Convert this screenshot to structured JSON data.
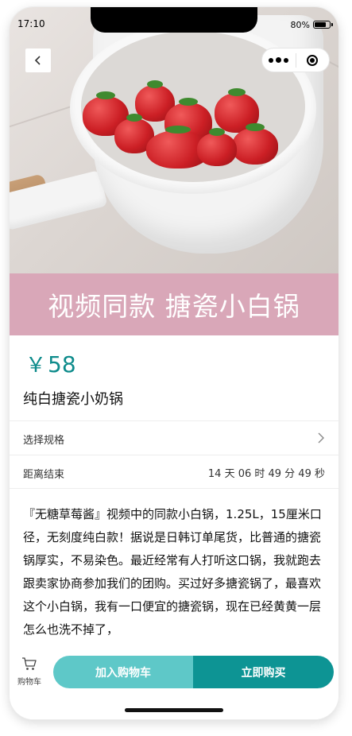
{
  "status_bar": {
    "time": "17:10",
    "battery_text": "80%",
    "battery_level": 0.8
  },
  "hero": {
    "banner_text": "视频同款 搪瓷小白锅",
    "banner_color": "#d9a7b8"
  },
  "product": {
    "currency": "￥",
    "price": "58",
    "title": "纯白搪瓷小奶锅",
    "price_color": "#0d8b8b"
  },
  "rows": {
    "spec_label": "选择规格",
    "countdown_label": "距离结束",
    "countdown_value": "14 天 06 时 49 分 49 秒"
  },
  "description": {
    "text": "『无糖草莓酱』视频中的同款小白锅，1.25L，15厘米口径，无刻度纯白款！据说是日韩订单尾货，比普通的搪瓷锅厚实，不易染色。最近经常有人打听这口锅，我就跑去跟卖家协商参加我们的团购。买过好多搪瓷锅了，最喜欢这个小白锅，我有一口便宜的搪瓷锅，现在已经黄黄一层怎么也洗不掉了，"
  },
  "bottom_bar": {
    "cart_label": "购物车",
    "add_to_cart": "加入购物车",
    "buy_now": "立即购买",
    "add_color": "#5ec8c8",
    "buy_color": "#0d9494"
  }
}
